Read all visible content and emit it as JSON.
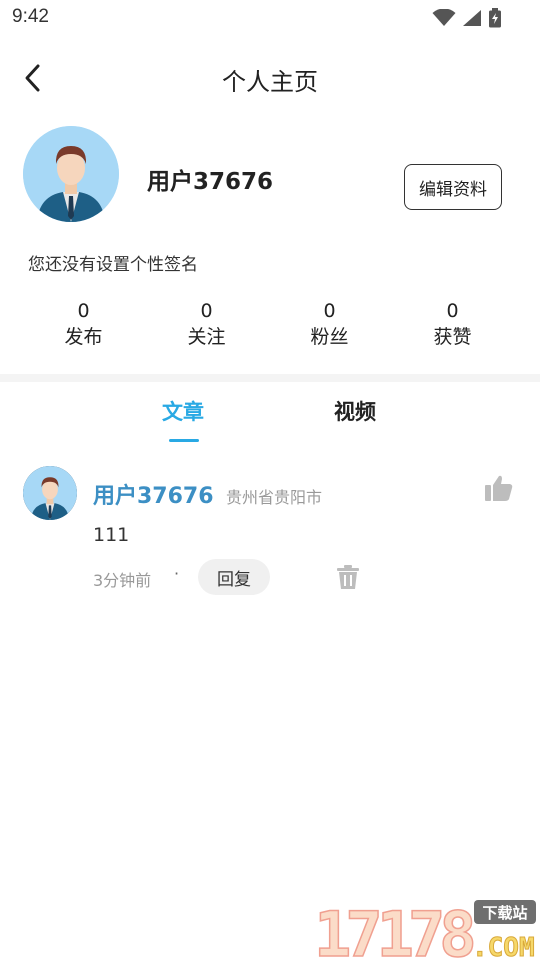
{
  "status_bar": {
    "time": "9:42"
  },
  "header": {
    "title": "个人主页"
  },
  "profile": {
    "username": "用户37676",
    "edit_label": "编辑资料",
    "signature": "您还没有设置个性签名"
  },
  "stats": [
    {
      "value": "0",
      "label": "发布"
    },
    {
      "value": "0",
      "label": "关注"
    },
    {
      "value": "0",
      "label": "粉丝"
    },
    {
      "value": "0",
      "label": "获赞"
    }
  ],
  "tabs": [
    {
      "label": "文章",
      "active": true
    },
    {
      "label": "视频",
      "active": false
    }
  ],
  "posts": [
    {
      "username": "用户37676",
      "location": "贵州省贵阳市",
      "content": "111",
      "time": "3分钟前",
      "separator": "·",
      "reply_label": "回复"
    }
  ],
  "watermark": {
    "digits": "17178",
    "badge": "下载站",
    "suffix": ".COM"
  },
  "colors": {
    "accent": "#29a9e4",
    "username_link": "#3c8fc4",
    "muted": "#999999"
  },
  "icons": [
    "back-arrow-icon",
    "wifi-icon",
    "signal-icon",
    "battery-icon",
    "thumbs-up-icon",
    "trash-icon"
  ]
}
